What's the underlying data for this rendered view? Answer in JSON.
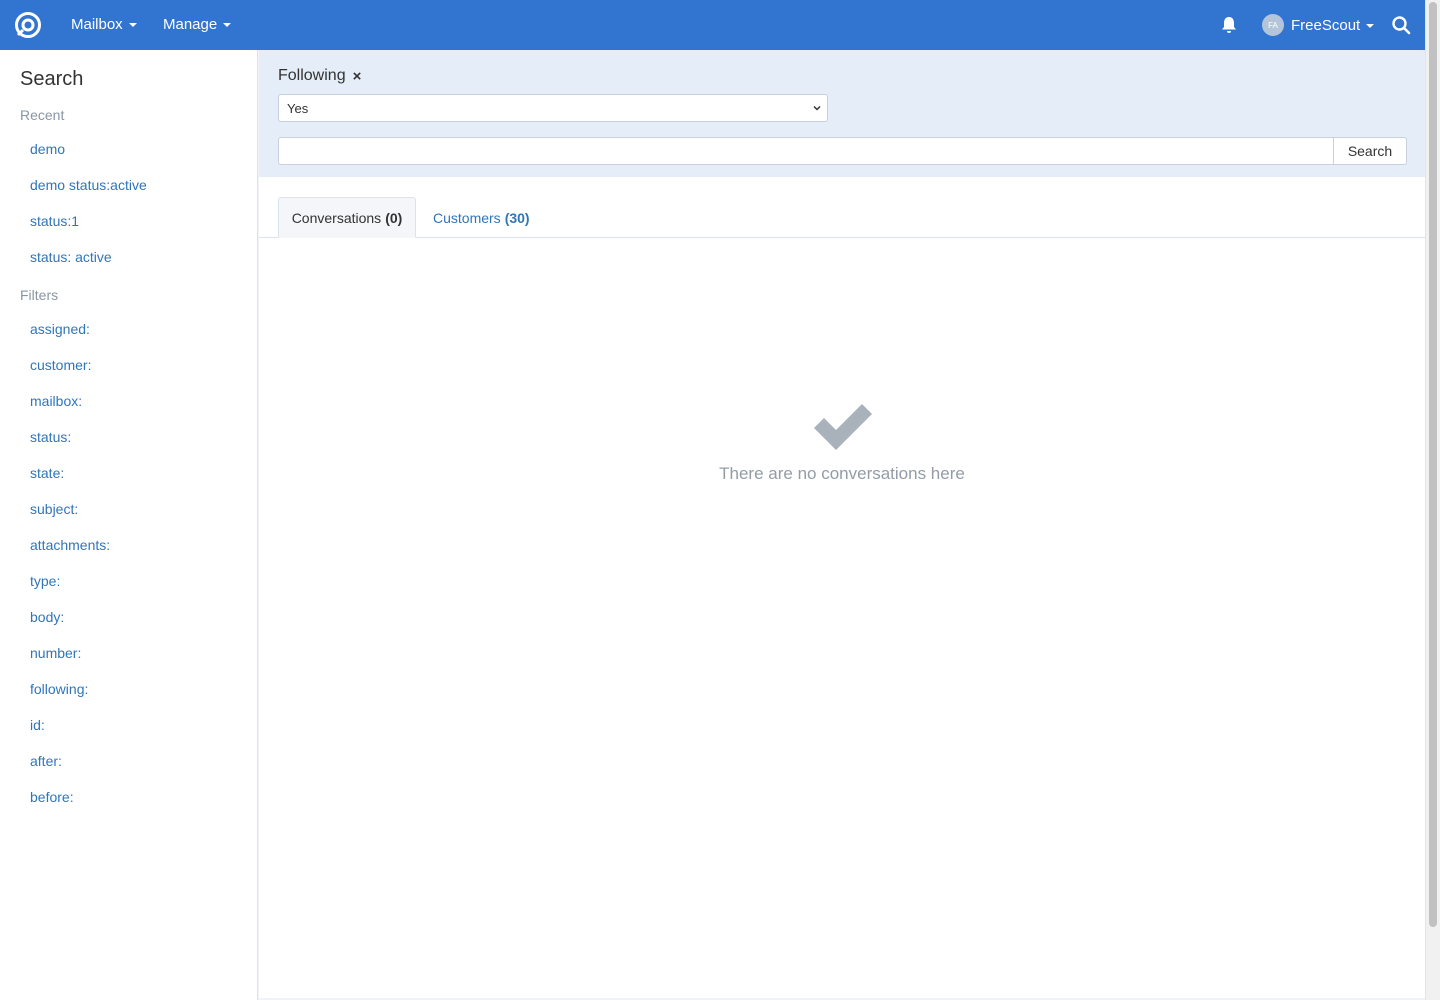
{
  "navbar": {
    "menus": [
      {
        "label": "Mailbox"
      },
      {
        "label": "Manage"
      }
    ],
    "user": {
      "initials": "FA",
      "name": "FreeScout"
    },
    "icons": {
      "logo": "freescout-logo-icon",
      "notifications": "bell-icon",
      "search": "search-icon"
    },
    "color": "#3175d1"
  },
  "sidebar": {
    "title": "Search",
    "recent_label": "Recent",
    "recent": [
      "demo",
      "demo status:active",
      "status:1",
      "status: active"
    ],
    "filters_label": "Filters",
    "filters": [
      "assigned:",
      "customer:",
      "mailbox:",
      "status:",
      "state:",
      "subject:",
      "attachments:",
      "type:",
      "body:",
      "number:",
      "following:",
      "id:",
      "after:",
      "before:"
    ]
  },
  "search": {
    "filter": {
      "label": "Following",
      "remove": "×",
      "selected": "Yes"
    },
    "query": {
      "value": "",
      "placeholder": ""
    },
    "button_label": "Search"
  },
  "tabs": [
    {
      "label": "Conversations",
      "count": "(0)",
      "active": true
    },
    {
      "label": "Customers",
      "count": "(30)",
      "active": false
    }
  ],
  "empty_state": {
    "icon": "checkmark-icon",
    "text": "There are no conversations here"
  },
  "colors": {
    "link": "#3175b9",
    "panel": "#e4edf8",
    "muted": "#939ca6"
  }
}
